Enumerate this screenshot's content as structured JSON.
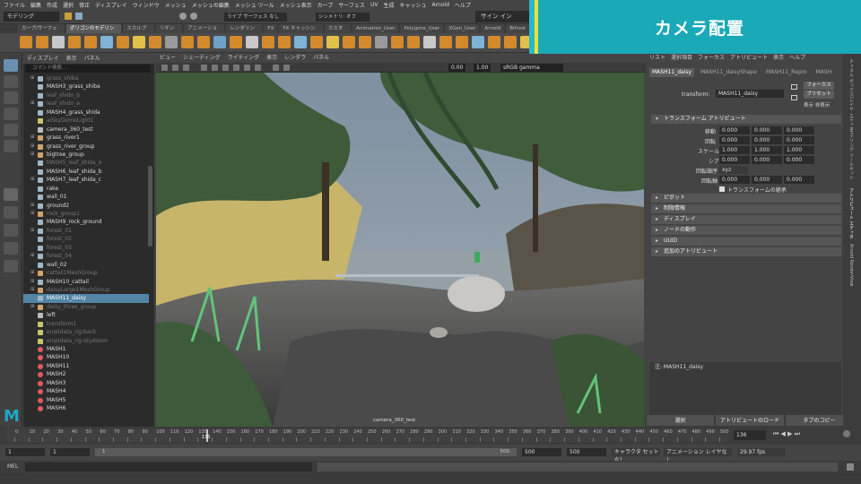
{
  "menubar": [
    "ファイル",
    "編集",
    "作成",
    "選択",
    "修正",
    "ディスプレイ",
    "ウィンドウ",
    "メッシュ",
    "メッシュの編集",
    "メッシュ ツール",
    "メッシュ表示",
    "カーブ",
    "サーフェス",
    "UV",
    "生成",
    "キャッシュ",
    "Arnold",
    "ヘルプ"
  ],
  "status": {
    "mode": "モデリング",
    "live": "ライブ サーフェス なし",
    "symmetry": "シンメトリ: オフ",
    "sign_in": "サイン イン"
  },
  "banner_title": "カメラ配置",
  "shelf_tabs": [
    "カーブ/サーフェス",
    "ポリゴンのモデリング",
    "スカルプト",
    "リギング",
    "アニメーション",
    "レンダリング",
    "FX",
    "FX キャッシング",
    "カスタム",
    "Animation_User",
    "Polygons_User",
    "XGen_User",
    "Arnold",
    "Bifrost"
  ],
  "outliner": {
    "menu": [
      "ディスプレイ",
      "表示",
      "パネル"
    ],
    "search_placeholder": "コマンド検索...",
    "rows": [
      {
        "label": "grass_shiba",
        "dim": true,
        "icon": "mesh"
      },
      {
        "label": "MASH3_grass_shiba",
        "dim": false,
        "icon": "mesh"
      },
      {
        "label": "leaf_shido_b",
        "dim": true,
        "icon": "mesh"
      },
      {
        "label": "leaf_shido_a",
        "dim": true,
        "icon": "mesh"
      },
      {
        "label": "MASH4_grass_shida",
        "dim": false,
        "icon": "mesh"
      },
      {
        "label": "aiSkyDomeLight1",
        "dim": true,
        "icon": "light"
      },
      {
        "label": "camera_360_test",
        "dim": false,
        "icon": "camera"
      },
      {
        "label": "grass_river1",
        "dim": false,
        "icon": "group"
      },
      {
        "label": "grass_river_group",
        "dim": false,
        "icon": "group"
      },
      {
        "label": "bigtree_group",
        "dim": false,
        "icon": "group"
      },
      {
        "label": "MASH5_leaf_shida_a",
        "dim": true,
        "icon": "mesh"
      },
      {
        "label": "MASH6_leaf_shida_b",
        "dim": false,
        "icon": "mesh"
      },
      {
        "label": "MASH7_leaf_shida_c",
        "dim": false,
        "icon": "mesh"
      },
      {
        "label": "rake",
        "dim": false,
        "icon": "mesh"
      },
      {
        "label": "wall_01",
        "dim": false,
        "icon": "mesh"
      },
      {
        "label": "ground2",
        "dim": false,
        "icon": "mesh"
      },
      {
        "label": "rock_group1",
        "dim": true,
        "icon": "group"
      },
      {
        "label": "MASH9_rock_ground",
        "dim": false,
        "icon": "mesh"
      },
      {
        "label": "forest_01",
        "dim": true,
        "icon": "mesh"
      },
      {
        "label": "forest_02",
        "dim": true,
        "icon": "mesh"
      },
      {
        "label": "forest_03",
        "dim": true,
        "icon": "mesh"
      },
      {
        "label": "forest_04",
        "dim": true,
        "icon": "mesh"
      },
      {
        "label": "wall_02",
        "dim": false,
        "icon": "mesh"
      },
      {
        "label": "cattail1MeshGroup",
        "dim": true,
        "icon": "group"
      },
      {
        "label": "MASH10_cattail",
        "dim": false,
        "icon": "mesh"
      },
      {
        "label": "daisyLarge1MeshGroup",
        "dim": true,
        "icon": "group"
      },
      {
        "label": "MASH11_daisy",
        "dim": false,
        "icon": "mesh",
        "selected": true
      },
      {
        "label": "daisy_three_group",
        "dim": true,
        "icon": "group"
      },
      {
        "label": "left",
        "dim": false,
        "icon": "camera"
      },
      {
        "label": "transform1",
        "dim": true,
        "icon": "light"
      },
      {
        "label": "enjeldata_rig:back",
        "dim": true,
        "icon": "light"
      },
      {
        "label": "enjeldata_rig:skydoom",
        "dim": true,
        "icon": "light"
      },
      {
        "label": "MASH1",
        "dim": false,
        "icon": "mash"
      },
      {
        "label": "MASH10",
        "dim": false,
        "icon": "mash"
      },
      {
        "label": "MASH11",
        "dim": false,
        "icon": "mash"
      },
      {
        "label": "MASH2",
        "dim": false,
        "icon": "mash"
      },
      {
        "label": "MASH3",
        "dim": false,
        "icon": "mash"
      },
      {
        "label": "MASH4",
        "dim": false,
        "icon": "mash"
      },
      {
        "label": "MASH5",
        "dim": false,
        "icon": "mash"
      },
      {
        "label": "MASH6",
        "dim": false,
        "icon": "mash"
      }
    ]
  },
  "viewport": {
    "menu": [
      "ビュー",
      "シェーディング",
      "ライティング",
      "表示",
      "レンダラ",
      "パネル"
    ],
    "exposure": "0.00",
    "gamma": "1.00",
    "colorspace": "sRGB gamma",
    "camera_label": "camera_360_test"
  },
  "attr": {
    "top_menu": [
      "リスト",
      "選択項目",
      "フォーカス",
      "アトリビュート",
      "表示",
      "ヘルプ"
    ],
    "tabs": [
      "MASH11_daisy",
      "MASH11_daisyShape",
      "MASH11_Repro",
      "MASH"
    ],
    "transform_label": "transform:",
    "transform_value": "MASH11_daisy",
    "focus_btn": "フォーカス",
    "preset_btn": "プリセット",
    "show_hide": "表示  非表示",
    "section_transform": "トランスフォーム アトリビュート",
    "translate_label": "移動",
    "rotate_label": "回転",
    "scale_label": "スケール",
    "shear_label": "シア",
    "rotate_order_label": "回転順序",
    "rotate_axis_label": "回転軸",
    "translate": [
      "0.000",
      "0.000",
      "0.000"
    ],
    "rotate": [
      "0.000",
      "0.000",
      "0.000"
    ],
    "scale": [
      "1.000",
      "1.000",
      "1.000"
    ],
    "shear": [
      "0.000",
      "0.000",
      "0.000"
    ],
    "rotate_order": "xyz",
    "rotate_axis": [
      "0.000",
      "0.000",
      "0.000"
    ],
    "inherit": "トランスフォームの継承",
    "sections": [
      "ピボット",
      "制限情報",
      "ディスプレイ",
      "ノードの動作",
      "UUID",
      "追加のアトリビュート"
    ],
    "notes_label": "注: MASH11_daisy",
    "bottom_buttons": [
      "選択",
      "アトリビュートのロード",
      "タブのコピー"
    ]
  },
  "side_tabs": [
    "チャネル ボックス/レイヤ エディタ",
    "モデリング ツールキット",
    "アトリビュート エディタ",
    "Arnold RenderView"
  ],
  "timeline": {
    "ticks": [
      "0",
      "10",
      "20",
      "30",
      "40",
      "50",
      "60",
      "70",
      "80",
      "90",
      "100",
      "110",
      "120",
      "130",
      "140",
      "150",
      "160",
      "170",
      "180",
      "190",
      "200",
      "210",
      "220",
      "230",
      "240",
      "250",
      "260",
      "270",
      "280",
      "290",
      "300",
      "310",
      "320",
      "330",
      "340",
      "350",
      "360",
      "370",
      "380",
      "390",
      "400",
      "410",
      "420",
      "430",
      "440",
      "450",
      "460",
      "470",
      "480",
      "490",
      "500"
    ],
    "current": "136",
    "current_field": "136",
    "max_frame": 500
  },
  "range": {
    "start": "1",
    "start2": "1",
    "slider_start": "1",
    "slider_end": "500",
    "end": "500",
    "end2": "500",
    "character": "キャラクタ セットなし",
    "anim_layer": "アニメーション レイヤなし",
    "fps": "29.97 fps"
  },
  "cmdline": {
    "label": "MEL"
  },
  "colors": {
    "accent_banner": "#19a9b7",
    "banner_stripe": "#e6e33a",
    "selection": "#5285a6",
    "maya_logo": "#1ba9c6"
  }
}
